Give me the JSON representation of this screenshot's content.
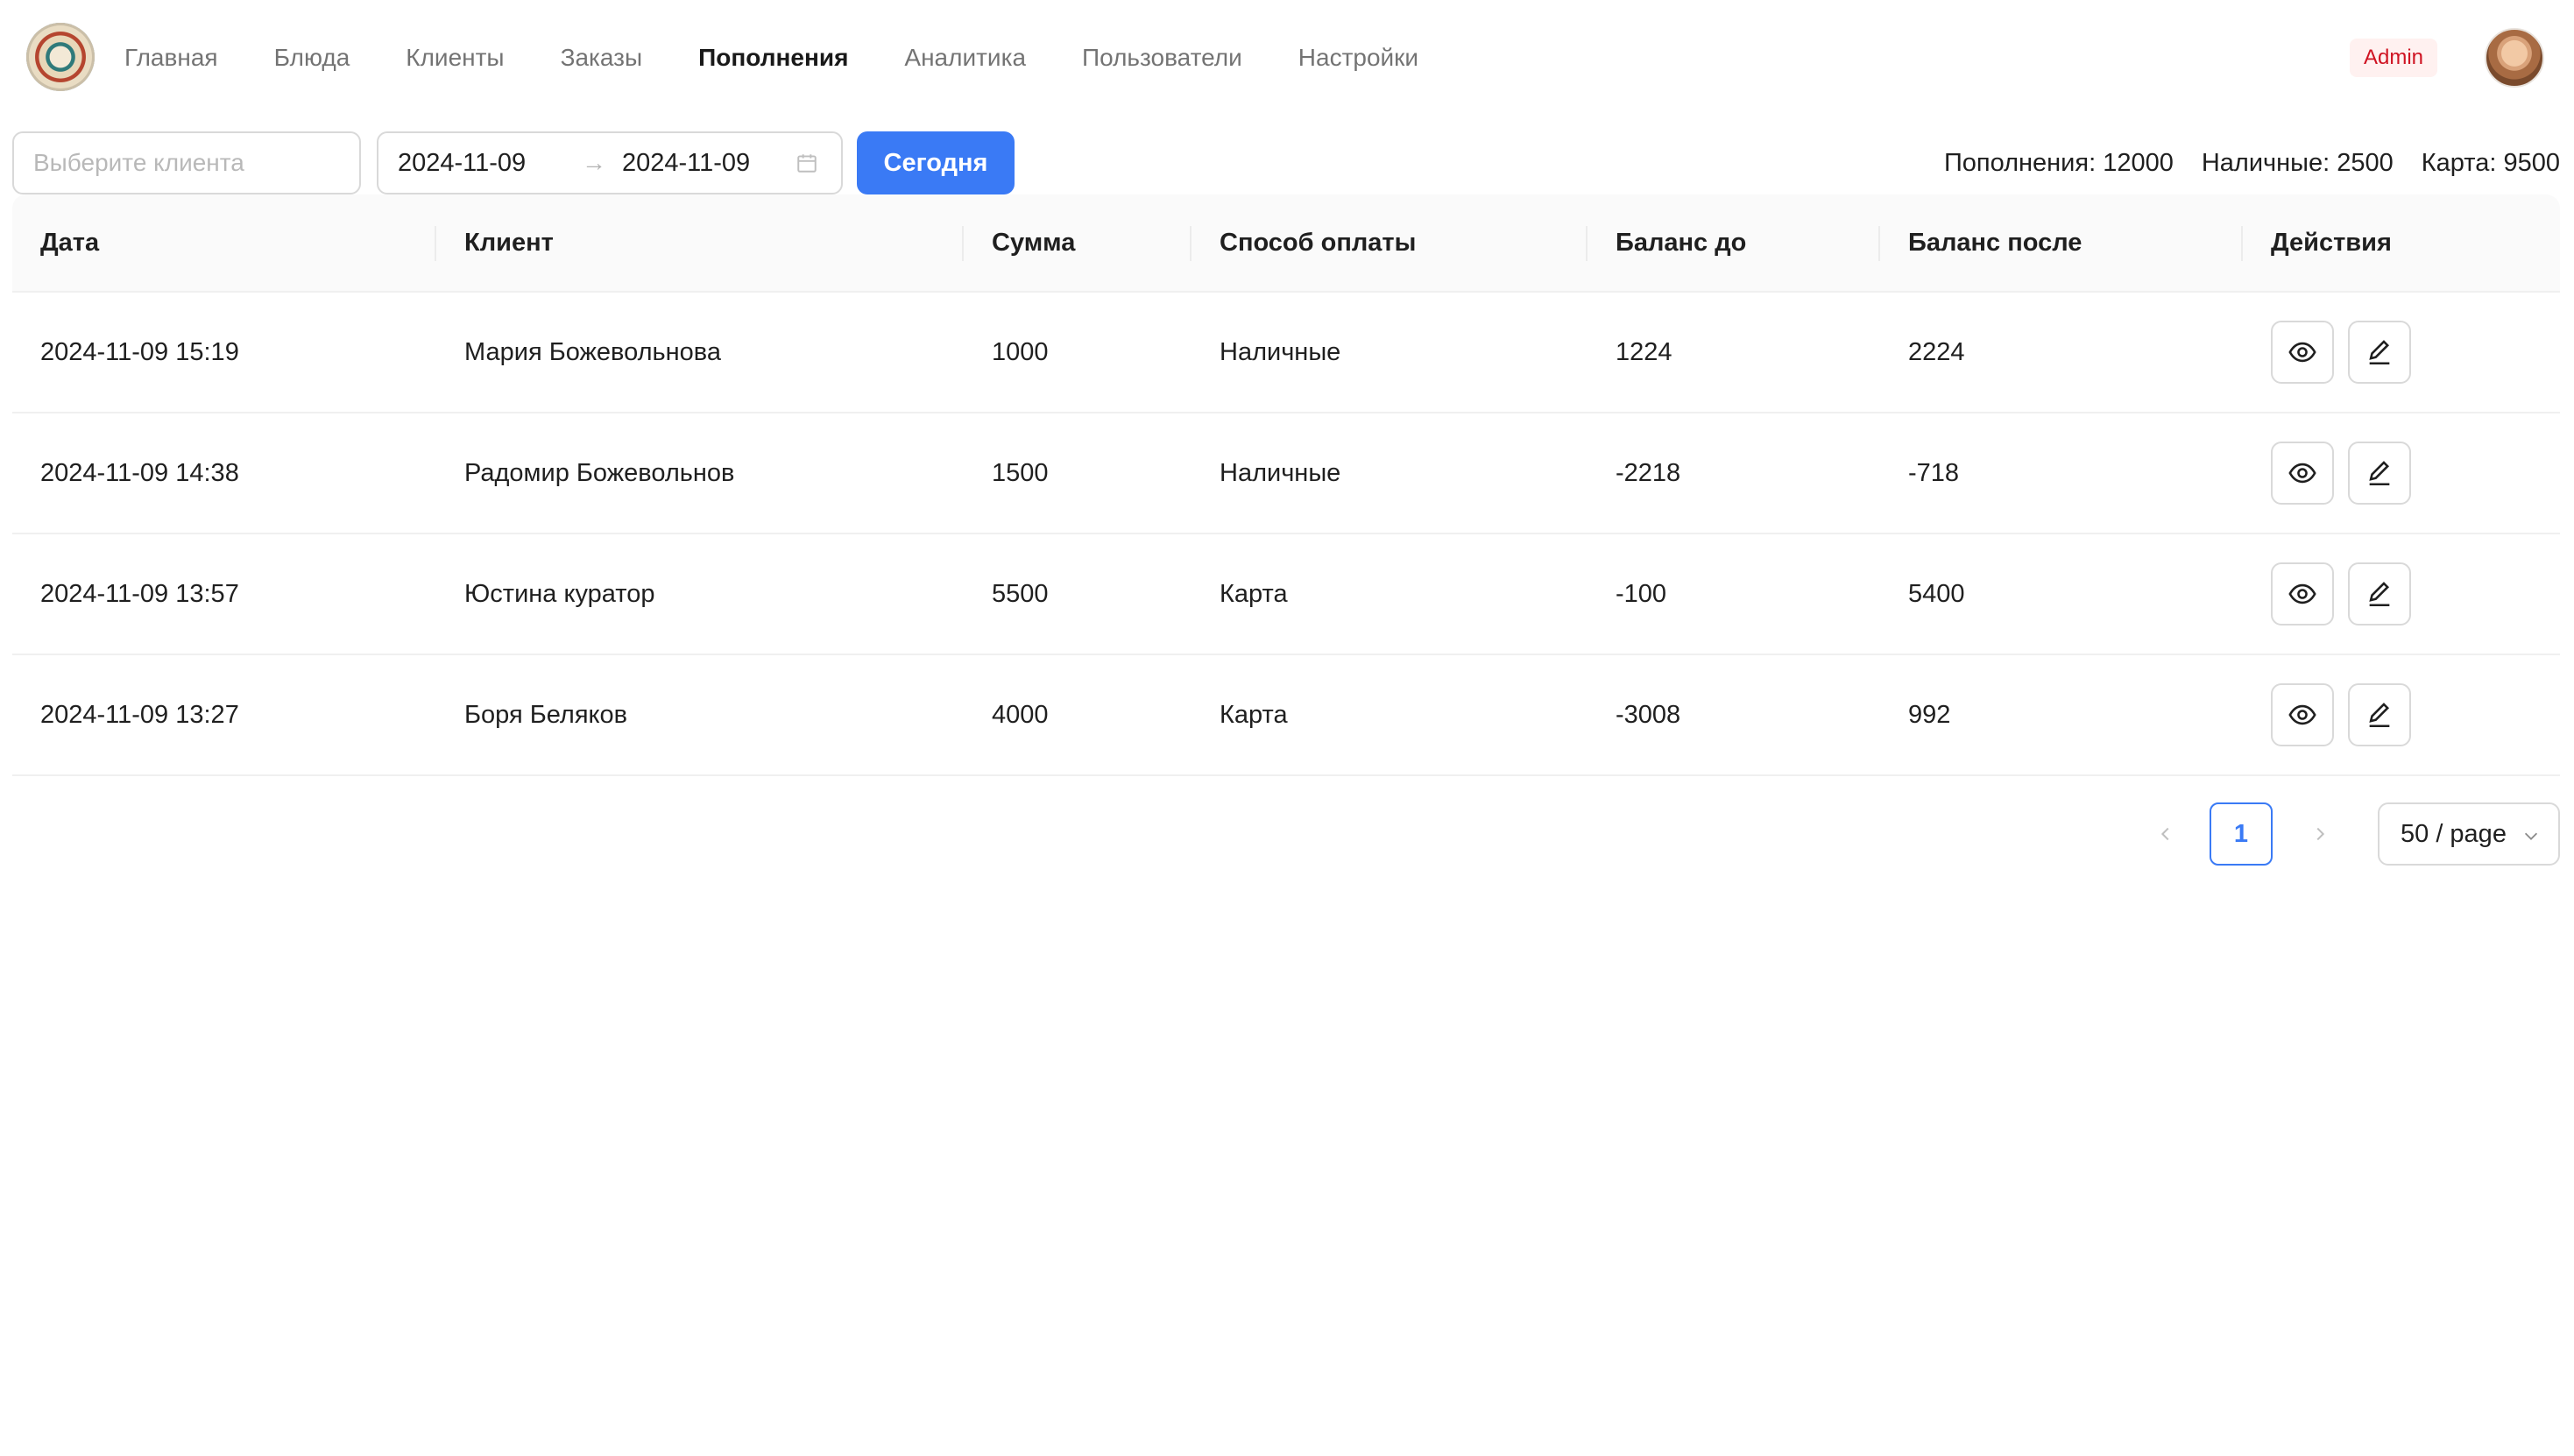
{
  "header": {
    "nav": [
      {
        "label": "Главная",
        "active": false
      },
      {
        "label": "Блюда",
        "active": false
      },
      {
        "label": "Клиенты",
        "active": false
      },
      {
        "label": "Заказы",
        "active": false
      },
      {
        "label": "Пополнения",
        "active": true
      },
      {
        "label": "Аналитика",
        "active": false
      },
      {
        "label": "Пользователи",
        "active": false
      },
      {
        "label": "Настройки",
        "active": false
      }
    ],
    "role_badge": "Admin"
  },
  "toolbar": {
    "client_placeholder": "Выберите клиента",
    "date_from": "2024-11-09",
    "date_to": "2024-11-09",
    "range_separator": "→",
    "today_button": "Сегодня"
  },
  "summary": {
    "total": "Пополнения: 12000",
    "cash": "Наличные: 2500",
    "card": "Карта: 9500"
  },
  "table": {
    "columns": [
      "Дата",
      "Клиент",
      "Сумма",
      "Способ оплаты",
      "Баланс до",
      "Баланс после",
      "Действия"
    ],
    "rows": [
      {
        "date": "2024-11-09 15:19",
        "client": "Мария Божевольнова",
        "amount": "1000",
        "method": "Наличные",
        "before": "1224",
        "after": "2224"
      },
      {
        "date": "2024-11-09 14:38",
        "client": "Радомир Божевольнов",
        "amount": "1500",
        "method": "Наличные",
        "before": "-2218",
        "after": "-718"
      },
      {
        "date": "2024-11-09 13:57",
        "client": "Юстина куратор",
        "amount": "5500",
        "method": "Карта",
        "before": "-100",
        "after": "5400"
      },
      {
        "date": "2024-11-09 13:27",
        "client": "Боря Беляков",
        "amount": "4000",
        "method": "Карта",
        "before": "-3008",
        "after": "992"
      }
    ]
  },
  "pagination": {
    "current_page": "1",
    "page_size": "50 / page"
  },
  "colors": {
    "primary": "#3a7af5",
    "badge_text": "#cf1322",
    "badge_bg": "#fff1f0"
  },
  "icons": {
    "view": "eye-icon",
    "edit": "pencil-icon",
    "calendar": "calendar-icon",
    "prev": "chevron-left-icon",
    "next": "chevron-right-icon",
    "dropdown": "chevron-down-icon"
  }
}
